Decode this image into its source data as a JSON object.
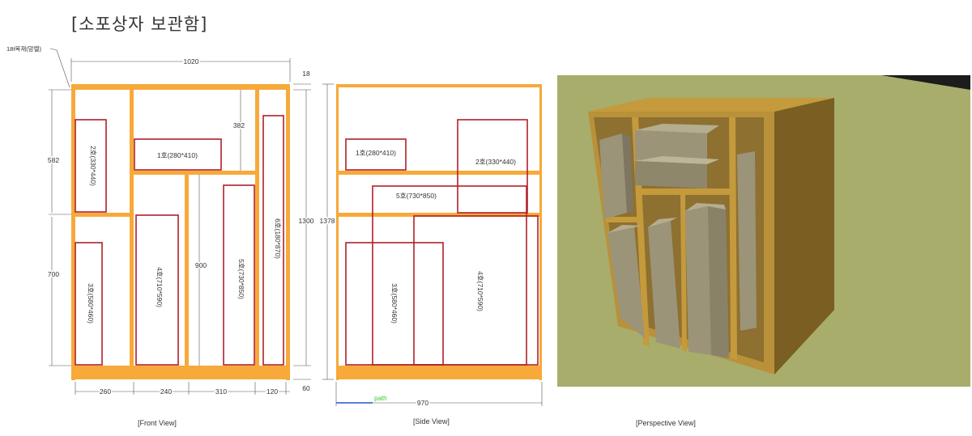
{
  "title": "[소포상자 보관함]",
  "material_note": "18t목재(망렐)",
  "front_view": {
    "caption": "[Front View]",
    "dims": {
      "width_total": "1020",
      "thickness": "18",
      "upper": "582",
      "lower": "700",
      "shelf_gap": "382",
      "inner_tall": "900",
      "height_total": "1300",
      "base": "60",
      "col1": "260",
      "col2": "240",
      "col3": "310",
      "col4": "120"
    },
    "boxes": {
      "b1": "1호(280*410)",
      "b2": "2호(330*440)",
      "b3": "3호(580*460)",
      "b4": "4호(710*590)",
      "b5": "5호(730*850)",
      "b6": "6호(180*870)"
    }
  },
  "side_view": {
    "caption": "[Side View]",
    "dims": {
      "height": "1378",
      "depth": "970"
    },
    "path_label": "path",
    "boxes": {
      "b1": "1호(280*410)",
      "b2": "2호(330*440)",
      "b5": "5호(730*850)",
      "b3": "3호(580*460)",
      "b4": "4호(710*590)"
    }
  },
  "perspective_view": {
    "caption": "[Perspective View]"
  },
  "colors": {
    "wood": "#f7a93a",
    "box_outline": "#b0202a",
    "dim_line": "#555555",
    "path_line": "#2255cc",
    "path_label": "#33cc33",
    "ground": "#a8ad6c",
    "cabinet_top": "#b8913a",
    "cabinet_side": "#7a5e22",
    "cabinet_interior": "#9a7a32",
    "box_grey": "#9c9478"
  }
}
